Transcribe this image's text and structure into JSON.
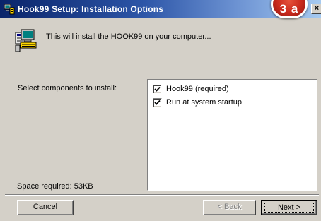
{
  "window": {
    "title": "Hook99 Setup: Installation Options",
    "close_label": "×",
    "app_icon": "installer-computer-icon"
  },
  "badge": {
    "text": "3 a"
  },
  "header": {
    "icon": "install-package-icon",
    "text": "This will install the HOOK99 on your computer..."
  },
  "components": {
    "label": "Select components to install:",
    "items": [
      {
        "label": "Hook99 (required)",
        "checked": true
      },
      {
        "label": "Run at system startup",
        "checked": true
      }
    ]
  },
  "space_required": "Space required: 53KB",
  "buttons": {
    "cancel": "Cancel",
    "back": "< Back",
    "next": "Next >"
  },
  "colors": {
    "titlebar_start": "#0a246a",
    "titlebar_end": "#a6caf0",
    "badge": "#c8291c",
    "dialog_bg": "#d4d0c8"
  }
}
